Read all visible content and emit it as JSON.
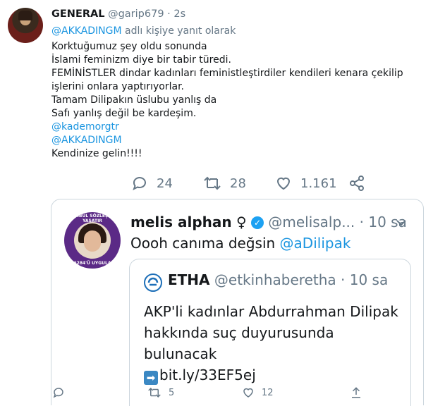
{
  "tweet": {
    "author_name": "GENERAL",
    "author_handle": "@garip679",
    "separator": "·",
    "time": "2s",
    "reply_mention": "@AKKADINGM",
    "reply_suffix": " adlı kişiye yanıt olarak",
    "lines": [
      "Korktuğumuz şey oldu sonunda",
      "İslami feminizm diye bir tabir türedi.",
      "FEMİNİSTLER dindar kadınları feministleştirdiler kendileri kenara çekilip işlerini onlara yaptırıyorlar.",
      "Tamam Dilipakın üslubu yanlış da",
      "Safı yanlış değil be kardeşim."
    ],
    "mentions": [
      "@kademorgtr",
      "@AKKADINGM"
    ],
    "closing": "Kendinize gelin!!!!",
    "actions": {
      "reply_icon": "comment-icon",
      "reply_count": "24",
      "retweet_icon": "retweet-icon",
      "retweet_count": "28",
      "like_icon": "heart-icon",
      "like_count": "1.161",
      "share_icon": "share-icon"
    }
  },
  "embedded": {
    "author_name": "melis alphan",
    "author_symbol": "♀",
    "verified_icon": "verified-badge-icon",
    "verified_glyph": "✓",
    "author_handle": "@melisalp...",
    "separator": "·",
    "time": "10 sa",
    "text_prefix": "Oooh canıma değsin ",
    "text_mention": "@aDilipak",
    "avatar_text_top": "İSTANBUL SÖZLEŞMESİ YAŞATIR",
    "avatar_text_bottom": "6284'Ü UYGULA",
    "quote": {
      "logo_icon": "etha-logo-icon",
      "author_name": "ETHA",
      "author_handle": "@etkinhaberetha",
      "separator": "·",
      "time": "10 sa",
      "text": "AKP'li kadınlar Abdurrahman Dilipak hakkında suç duyurusunda bulunacak",
      "link_arrow": "➡",
      "link": "bit.ly/33EF5ej"
    },
    "actions": {
      "reply_icon": "comment-icon",
      "retweet_icon": "retweet-icon",
      "retweet_count": "5",
      "like_icon": "heart-icon",
      "like_count": "12",
      "share_icon": "share-icon"
    }
  },
  "colors": {
    "link": "#1b95e0",
    "secondary_text": "#657786",
    "border": "#ccd6dd",
    "verified": "#1da1f2"
  }
}
